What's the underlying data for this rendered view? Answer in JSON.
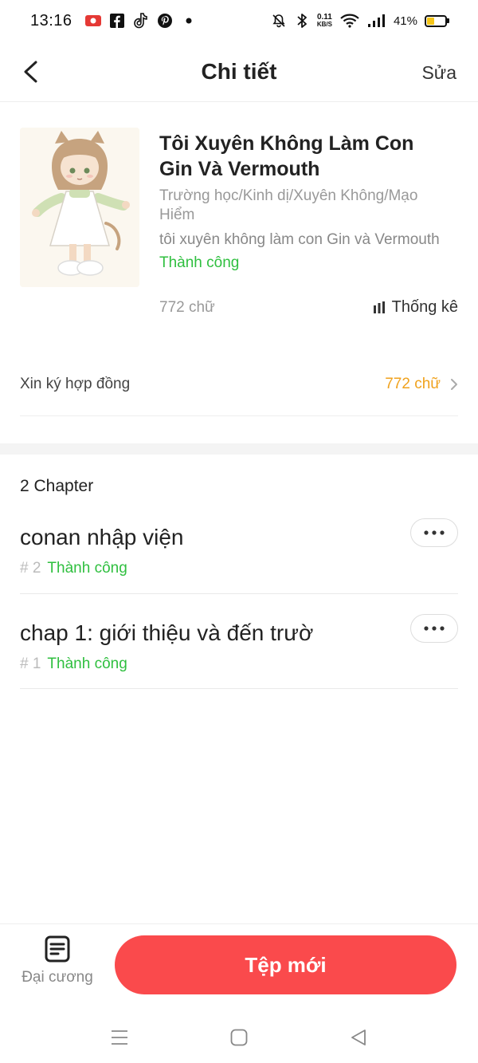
{
  "status_bar": {
    "time": "13:16",
    "net_speed_value": "0.11",
    "net_speed_unit": "KB/S",
    "battery_percent": "41%",
    "battery_level": 0.41
  },
  "header": {
    "title": "Chi tiết",
    "edit_label": "Sửa"
  },
  "book": {
    "title": "Tôi Xuyên Không Làm Con Gin Và Vermouth",
    "genre": "Trường học/Kinh dị/Xuyên Không/Mạo Hiểm",
    "description": "tôi xuyên không làm con Gin và Vermouth",
    "status": "Thành công",
    "word_count": "772 chữ",
    "stats_label": "Thống kê"
  },
  "contract": {
    "label": "Xin ký hợp đồng",
    "value": "772 chữ"
  },
  "chapters": {
    "count_label": "2 Chapter",
    "items": [
      {
        "title": "conan nhập viện",
        "number": "# 2",
        "status": "Thành công"
      },
      {
        "title": "chap 1: giới thiệu và đến trườ",
        "number": "# 1",
        "status": "Thành công"
      }
    ]
  },
  "bottom_bar": {
    "outline_label": "Đại cương",
    "new_file_label": "Tệp mới"
  },
  "colors": {
    "accent_red": "#fa4a4c",
    "success_green": "#2fbf3f",
    "word_count_orange": "#f0a21d"
  }
}
